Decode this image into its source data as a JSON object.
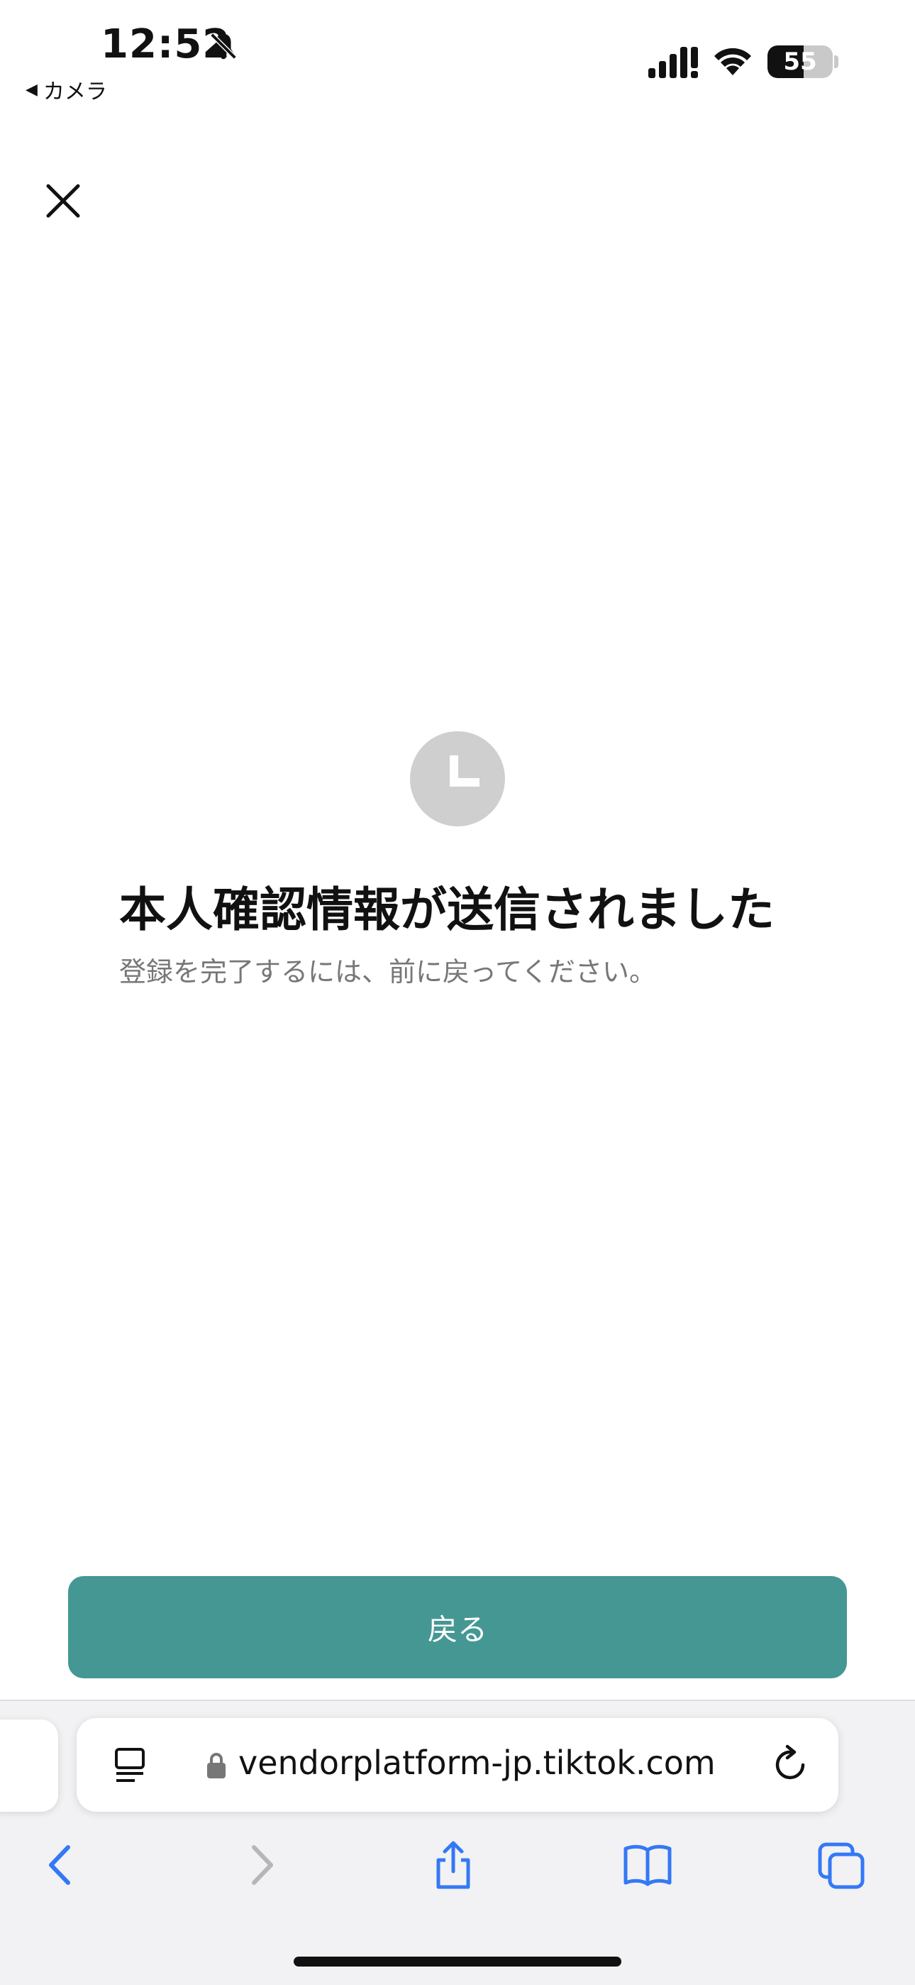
{
  "status_bar": {
    "time": "12:52",
    "back_app_label": "カメラ",
    "battery_level": "55",
    "battery_percent": 55
  },
  "main": {
    "title": "本人確認情報が送信されました",
    "subtitle": "登録を完了するには、前に戻ってください。",
    "back_button_label": "戻る"
  },
  "browser": {
    "url": "vendorplatform-jp.tiktok.com"
  },
  "colors": {
    "accent": "#459794",
    "ios_blue": "#3478f6",
    "icon_gray": "#cfcfcf"
  },
  "icons": [
    "bell-slash-icon",
    "signal-icon",
    "wifi-icon",
    "battery-icon",
    "close-icon",
    "clock-icon",
    "reader-icon",
    "lock-icon",
    "reload-icon",
    "back-arrow-icon",
    "forward-arrow-icon",
    "share-icon",
    "bookmarks-icon",
    "tabs-icon"
  ]
}
